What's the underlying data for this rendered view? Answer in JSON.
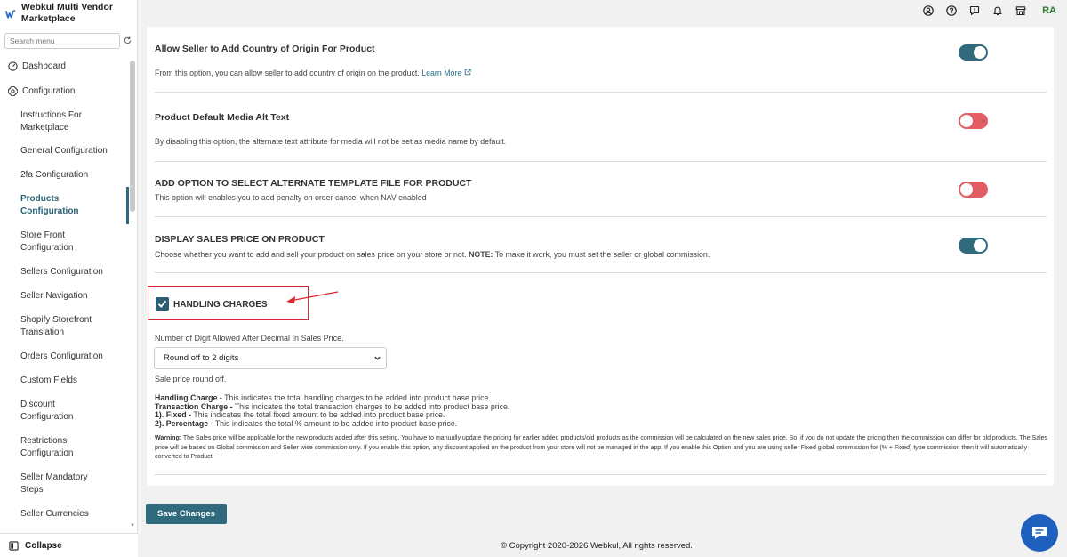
{
  "app": {
    "name": "Webkul Multi Vendor Marketplace",
    "logo_letter": "W"
  },
  "sidebar": {
    "search_placeholder": "Search menu",
    "dashboard": "Dashboard",
    "configuration": "Configuration",
    "items": [
      {
        "label": "Instructions For Marketplace"
      },
      {
        "label": "General Configuration"
      },
      {
        "label": "2fa Configuration"
      },
      {
        "label": "Products Configuration",
        "active": true
      },
      {
        "label": "Store Front Configuration"
      },
      {
        "label": "Sellers Configuration"
      },
      {
        "label": "Seller Navigation"
      },
      {
        "label": "Shopify Storefront Translation"
      },
      {
        "label": "Orders Configuration"
      },
      {
        "label": "Custom Fields"
      },
      {
        "label": "Discount Configuration"
      },
      {
        "label": "Restrictions Configuration"
      },
      {
        "label": "Seller Mandatory Steps"
      },
      {
        "label": "Seller Currencies"
      }
    ],
    "collapse": "Collapse"
  },
  "topbar": {
    "icons": [
      "user-circle-icon",
      "help-icon",
      "chat-bubble-icon",
      "bell-icon",
      "store-icon"
    ],
    "avatar": "RA"
  },
  "settings": [
    {
      "title": "Allow Seller to Add Country of Origin For Product",
      "desc": "From this option, you can allow seller to add country of origin on the product.",
      "link": "Learn More",
      "state": "on"
    },
    {
      "title": "Product Default Media Alt Text",
      "desc": "By disabling this option, the alternate text attribute for media will not be set as media name by default.",
      "state": "off"
    },
    {
      "title": "ADD OPTION TO SELECT ALTERNATE TEMPLATE FILE FOR PRODUCT",
      "desc": "This option will enables you to add penalty on order cancel when NAV enabled",
      "state": "off"
    },
    {
      "title": "DISPLAY SALES PRICE ON PRODUCT",
      "desc": "Choose whether you want to add and sell your product on sales price on your store or not.",
      "note_label": "NOTE:",
      "note_text": "To make it work, you must set the seller or global commission.",
      "state": "on"
    }
  ],
  "handling": {
    "label": "HANDLING CHARGES",
    "checked": true,
    "digits_label": "Number of Digit Allowed After Decimal In Sales Price.",
    "select_value": "Round off to 2 digits",
    "roundoff_note": "Sale price round off.",
    "defs": [
      {
        "term": "Handling Charge -",
        "text": "This indicates the total handling charges to be added into product base price."
      },
      {
        "term": "Transaction Charge -",
        "text": "This indicates the total transaction charges to be added into product base price."
      },
      {
        "term": "1). Fixed -",
        "text": "This indicates the total fixed amount to be added into product base price."
      },
      {
        "term": "2). Percentage -",
        "text": "This indicates the total % amount to be added into product base price."
      }
    ],
    "warning_label": "Warning:",
    "warning_text": "The Sales price will be applicable for the new products added after this setting. You have to manually update the pricing for earlier added products/old products as the commission will be calculated on the new sales price. So, if you do not update the pricing then the commission can differ for old products. The Sales price will be based on Global commission and Seller wise commission only. If you enable this option, any discount applied on the product from your store will not be managed in the app. If you enable this Option and you are using seller Fixed global commission for (% + Fixed) type commission then it will automatically converted to Product."
  },
  "footer": {
    "save_label": "Save Changes",
    "copyright": "© Copyright 2020-2026 Webkul, All rights reserved."
  },
  "colors": {
    "accent": "#2f6a7d",
    "toggle_off": "#e25c64",
    "highlight_red": "#d9282f",
    "chat_blue": "#1f5fbd"
  }
}
